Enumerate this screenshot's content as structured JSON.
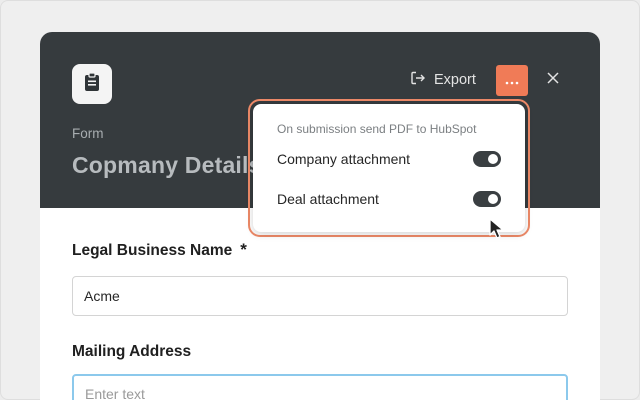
{
  "header": {
    "export_label": "Export",
    "eyebrow": "Form",
    "title": "Copmany Details"
  },
  "form": {
    "fields": [
      {
        "label": "Legal Business Name",
        "required_mark": "*",
        "value": "Acme",
        "placeholder": ""
      },
      {
        "label": "Mailing Address",
        "value": "",
        "placeholder": "Enter text"
      }
    ]
  },
  "menu": {
    "heading": "On submission send PDF to HubSpot",
    "items": [
      {
        "label": "Company attachment",
        "on": true
      },
      {
        "label": "Deal attachment",
        "on": true
      }
    ]
  },
  "colors": {
    "header_bg": "#363b3e",
    "accent": "#f07b57",
    "focus_ring": "#8cc9ec"
  },
  "icons": [
    "clipboard-icon",
    "export-icon",
    "more-horizontal-icon",
    "close-icon",
    "mouse-pointer-icon"
  ]
}
